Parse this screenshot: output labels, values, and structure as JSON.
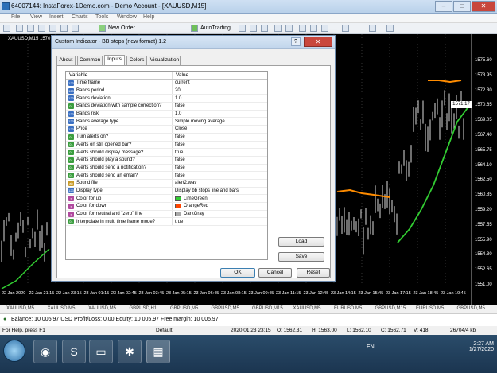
{
  "window": {
    "title": "64007144: InstaForex-1Demo.com - Demo Account - [XAUUSD,M15]"
  },
  "menu": [
    "File",
    "View",
    "Insert",
    "Charts",
    "Tools",
    "Window",
    "Help"
  ],
  "toolbar": {
    "new_order": "New Order",
    "autotrading": "AutoTrading"
  },
  "chart": {
    "symbol_label": "XAUUSD,M15  1570",
    "current_price": "1571.17",
    "price_ticks": [
      "1575.60",
      "1573.95",
      "1572.30",
      "1570.65",
      "1569.05",
      "1567.40",
      "1565.75",
      "1564.10",
      "1562.50",
      "1560.85",
      "1559.20",
      "1557.55",
      "1555.90",
      "1554.30",
      "1552.65",
      "1551.00"
    ],
    "time_ticks": [
      "22 Jan 2020",
      "22 Jan 21:15",
      "22 Jan 23:15",
      "23 Jan 01:15",
      "23 Jan 02:45",
      "23 Jan 03:45",
      "23 Jan 05:15",
      "23 Jan 06:45",
      "23 Jan 08:15",
      "23 Jan 09:45",
      "23 Jan 11:15",
      "23 Jan 12:45",
      "23 Jan 14:15",
      "23 Jan 15:45",
      "23 Jan 17:15",
      "23 Jan 18:45",
      "23 Jan 19:45"
    ]
  },
  "dialog": {
    "title": "Custom Indicator - BB stops (new format) 1.2",
    "help": "?",
    "tabs": [
      "About",
      "Common",
      "Inputs",
      "Colors",
      "Visualization"
    ],
    "active_tab": "Inputs",
    "columns": [
      "Variable",
      "Value"
    ],
    "params": [
      {
        "type": "num",
        "name": "Time frame",
        "value": "current"
      },
      {
        "type": "num",
        "name": "Bands period",
        "value": "20"
      },
      {
        "type": "num",
        "name": "Bands deviation",
        "value": "1.0"
      },
      {
        "type": "bool",
        "name": "Bands deviation with sample correction?",
        "value": "false"
      },
      {
        "type": "num",
        "name": "Bands risk",
        "value": "1.0"
      },
      {
        "type": "num",
        "name": "Bands average type",
        "value": "Simple moving average"
      },
      {
        "type": "num",
        "name": "Price",
        "value": "Close"
      },
      {
        "type": "bool",
        "name": "Turn alerts on?",
        "value": "false"
      },
      {
        "type": "bool",
        "name": "Alerts on still opened bar?",
        "value": "false"
      },
      {
        "type": "bool",
        "name": "Alerts should display message?",
        "value": "true"
      },
      {
        "type": "bool",
        "name": "Alerts should play a sound?",
        "value": "false"
      },
      {
        "type": "bool",
        "name": "Alerts should send a notification?",
        "value": "false"
      },
      {
        "type": "bool",
        "name": "Alerts should send an email?",
        "value": "false"
      },
      {
        "type": "str",
        "name": "Sound file",
        "value": "alert2.wav"
      },
      {
        "type": "num",
        "name": "Display type",
        "value": "Display bb stops line and bars"
      },
      {
        "type": "clr",
        "name": "Color for up",
        "value": "LimeGreen",
        "swatch": "#32cd32"
      },
      {
        "type": "clr",
        "name": "Color for down",
        "value": "OrangeRed",
        "swatch": "#ff4500"
      },
      {
        "type": "clr",
        "name": "Color for neutral and \"zero\" line",
        "value": "DarkGray",
        "swatch": "#a9a9a9"
      },
      {
        "type": "bool",
        "name": "Interpolate in multi time frame mode?",
        "value": "true"
      }
    ],
    "load_label": "Load",
    "save_label": "Save",
    "ok_label": "OK",
    "cancel_label": "Cancel",
    "reset_label": "Reset"
  },
  "symbol_tabs": [
    "XAUUSD,M5",
    "XAUUSD,M5",
    "XAUUSD,M5",
    "GBPUSD,H1",
    "GBPUSD,M5",
    "GBPUSD,M5",
    "GBPUSD,M15",
    "XAUUSD,M5",
    "EURUSD,M5",
    "GBPUSD,M15",
    "EURUSD,M5",
    "GBPUSD,M5"
  ],
  "balance_bar": {
    "text": "Balance: 10 005.97 USD  Profit/Loss: 0.00  Equity: 10 005.97  Free margin: 10 005.97"
  },
  "status": {
    "help": "For Help, press F1",
    "profile": "Default",
    "datetime": "2020.01.23 23:15",
    "open": "O: 1562.31",
    "high": "H: 1563.00",
    "low": "L: 1562.10",
    "close": "C: 1562.71",
    "volume": "V: 418",
    "traffic": "26704/4 kb"
  },
  "taskbar": {
    "lang": "EN",
    "time": "2:27 AM",
    "date": "1/27/2020"
  }
}
